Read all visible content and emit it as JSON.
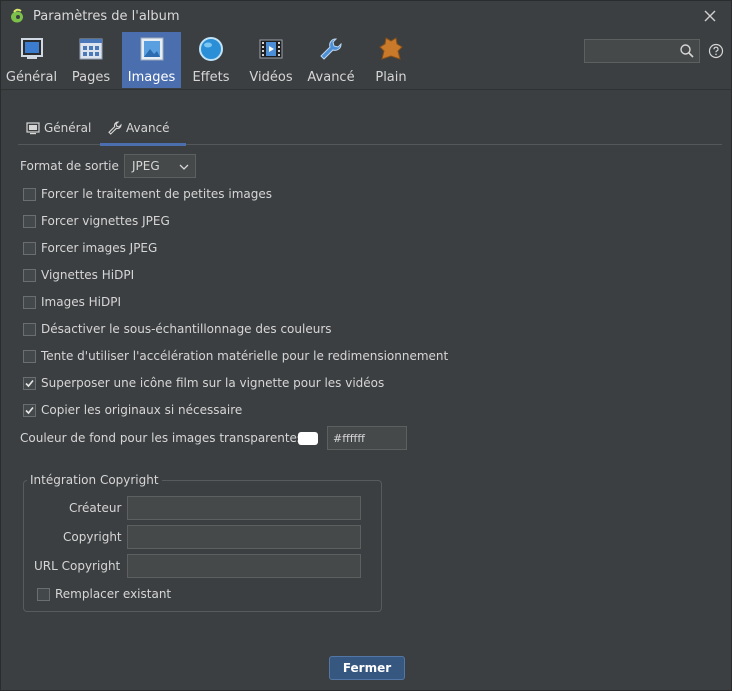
{
  "window": {
    "title": "Paramètres de l'album"
  },
  "toolbar": {
    "items": [
      {
        "label": "Général",
        "icon": "monitor-icon"
      },
      {
        "label": "Pages",
        "icon": "pages-grid-icon"
      },
      {
        "label": "Images",
        "icon": "image-icon",
        "active": true
      },
      {
        "label": "Effets",
        "icon": "sphere-icon"
      },
      {
        "label": "Vidéos",
        "icon": "film-icon"
      },
      {
        "label": "Avancé",
        "icon": "wrench-icon"
      },
      {
        "label": "Plain",
        "icon": "leather-icon"
      }
    ]
  },
  "search": {
    "placeholder": "",
    "value": ""
  },
  "subtabs": [
    {
      "label": "Général",
      "icon": "monitor-icon"
    },
    {
      "label": "Avancé",
      "icon": "wrench-icon",
      "active": true
    }
  ],
  "form": {
    "output_format_label": "Format de sortie",
    "output_format_value": "JPEG",
    "checkboxes": [
      {
        "label": "Forcer le traitement de petites images",
        "checked": false
      },
      {
        "label": "Forcer vignettes JPEG",
        "checked": false
      },
      {
        "label": "Forcer images JPEG",
        "checked": false
      },
      {
        "label": "Vignettes HiDPI",
        "checked": false
      },
      {
        "label": "Images HiDPI",
        "checked": false
      },
      {
        "label": "Désactiver le sous-échantillonnage des couleurs",
        "checked": false
      },
      {
        "label": "Tente d'utiliser l'accélération matérielle pour le redimensionnement",
        "checked": false
      },
      {
        "label": "Superposer une icône film sur la vignette pour les vidéos",
        "checked": true
      },
      {
        "label": "Copier les originaux si nécessaire",
        "checked": true
      }
    ],
    "bg_color_label": "Couleur de fond pour les images transparentes",
    "bg_color_value": "#ffffff"
  },
  "copyright": {
    "title": "Intégration Copyright",
    "creator_label": "Créateur",
    "creator_value": "",
    "copyright_label": "Copyright",
    "copyright_value": "",
    "url_label": "URL Copyright",
    "url_value": "",
    "replace_label": "Remplacer existant",
    "replace_checked": false
  },
  "footer": {
    "close_label": "Fermer"
  },
  "colors": {
    "accent": "#4b6eaf",
    "background": "#3c3f41",
    "button": "#365880"
  }
}
